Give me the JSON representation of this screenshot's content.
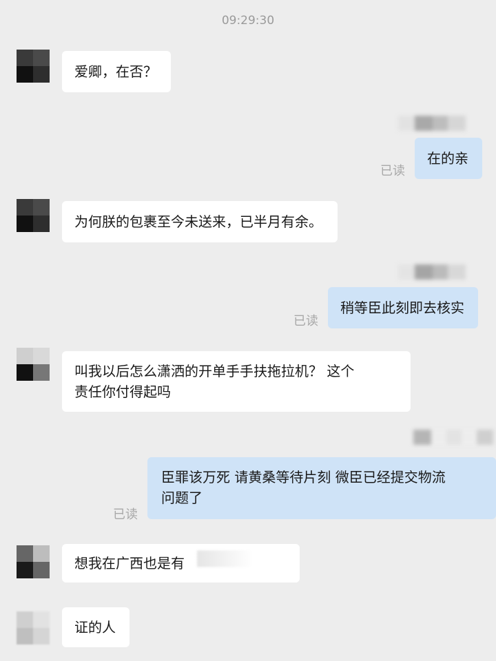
{
  "chat": {
    "timestamp": "09:29:30",
    "read_label": "已读",
    "messages": [
      {
        "side": "in",
        "text": "爱卿，在否？"
      },
      {
        "side": "out",
        "text": "在的亲"
      },
      {
        "side": "in",
        "text": "为何朕的包裹至今未送来，已半月有余。"
      },
      {
        "side": "out",
        "text": "稍等臣此刻即去核实"
      },
      {
        "side": "in",
        "line1": "叫我以后怎么潇洒的开单手手扶拖拉机？  这个",
        "line2": "责任你付得起吗"
      },
      {
        "side": "out",
        "line1": "臣罪该万死 请黄桑等待片刻 微臣已经提交物流",
        "line2": "问题了"
      },
      {
        "side": "in",
        "text": "想我在广西也是有"
      },
      {
        "side": "in",
        "text": "证的人"
      }
    ]
  }
}
